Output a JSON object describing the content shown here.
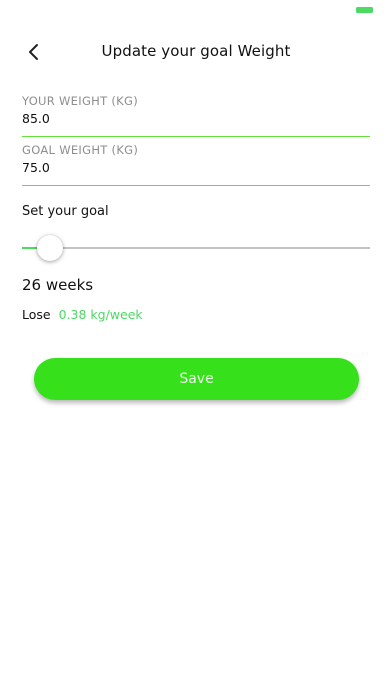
{
  "status_bar": {
    "battery_color": "#4cd964"
  },
  "header": {
    "back_icon": "chevron-left-icon",
    "title": "Update your goal Weight"
  },
  "fields": {
    "current_weight": {
      "label": "YOUR WEIGHT (KG)",
      "value": "85.0"
    },
    "goal_weight": {
      "label": "GOAL WEIGHT (KG)",
      "value": "75.0"
    }
  },
  "goal_slider": {
    "label": "Set your goal",
    "value_fraction": 0.08
  },
  "summary": {
    "duration": "26 weeks",
    "lose_label": "Lose",
    "rate": "0.38 kg/week"
  },
  "save_button": {
    "label": "Save"
  },
  "colors": {
    "accent": "#4cd964",
    "button": "#36e01b",
    "field_underline": "#63e03c"
  }
}
